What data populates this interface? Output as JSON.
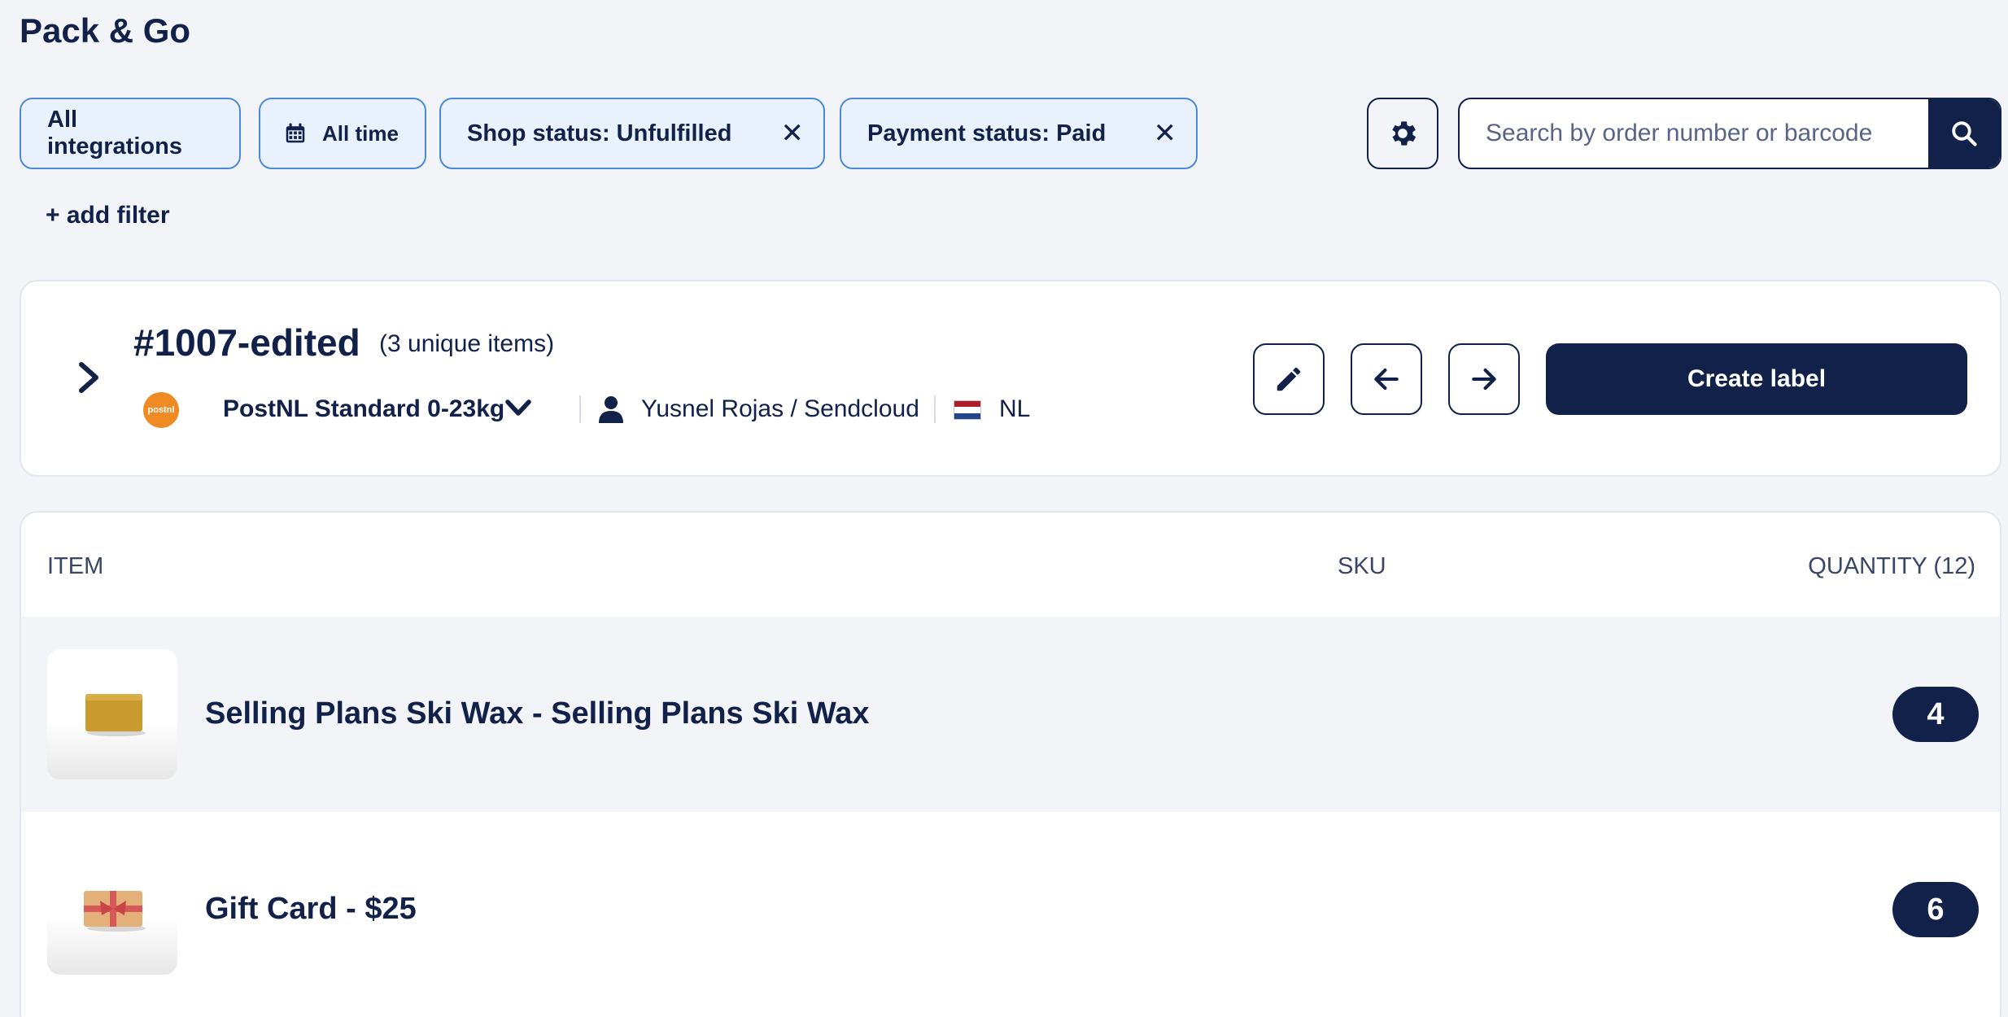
{
  "app": {
    "title": "Pack & Go"
  },
  "filters": {
    "integrations": "All integrations",
    "time": "All time",
    "shop_status": "Shop status: Unfulfilled",
    "payment_status": "Payment status: Paid",
    "remove_glyph": "✕",
    "add_filter": "+ add filter"
  },
  "search": {
    "placeholder": "Search by order number or barcode"
  },
  "order": {
    "number": "#1007-edited",
    "unique_items": "(3 unique items)",
    "carrier_logo_text": "postnl",
    "carrier": "PostNL Standard 0-23kg",
    "customer": "Yusnel Rojas / Sendcloud",
    "country": "NL",
    "create_label": "Create label"
  },
  "items_table": {
    "columns": {
      "item": "ITEM",
      "sku": "SKU",
      "quantity": "QUANTITY (12)"
    },
    "rows": [
      {
        "name": "Selling Plans Ski Wax - Selling Plans Ski Wax",
        "sku": "",
        "quantity": "4",
        "image": "ski-wax"
      },
      {
        "name": "Gift Card - $25",
        "sku": "",
        "quantity": "6",
        "image": "gift-card"
      }
    ]
  },
  "colors": {
    "primary": "#12214a",
    "chip_bg": "#e8f1fc",
    "chip_border": "#4a8ad8",
    "page_bg": "#f3f4f8",
    "postnl_orange": "#f08a24"
  }
}
